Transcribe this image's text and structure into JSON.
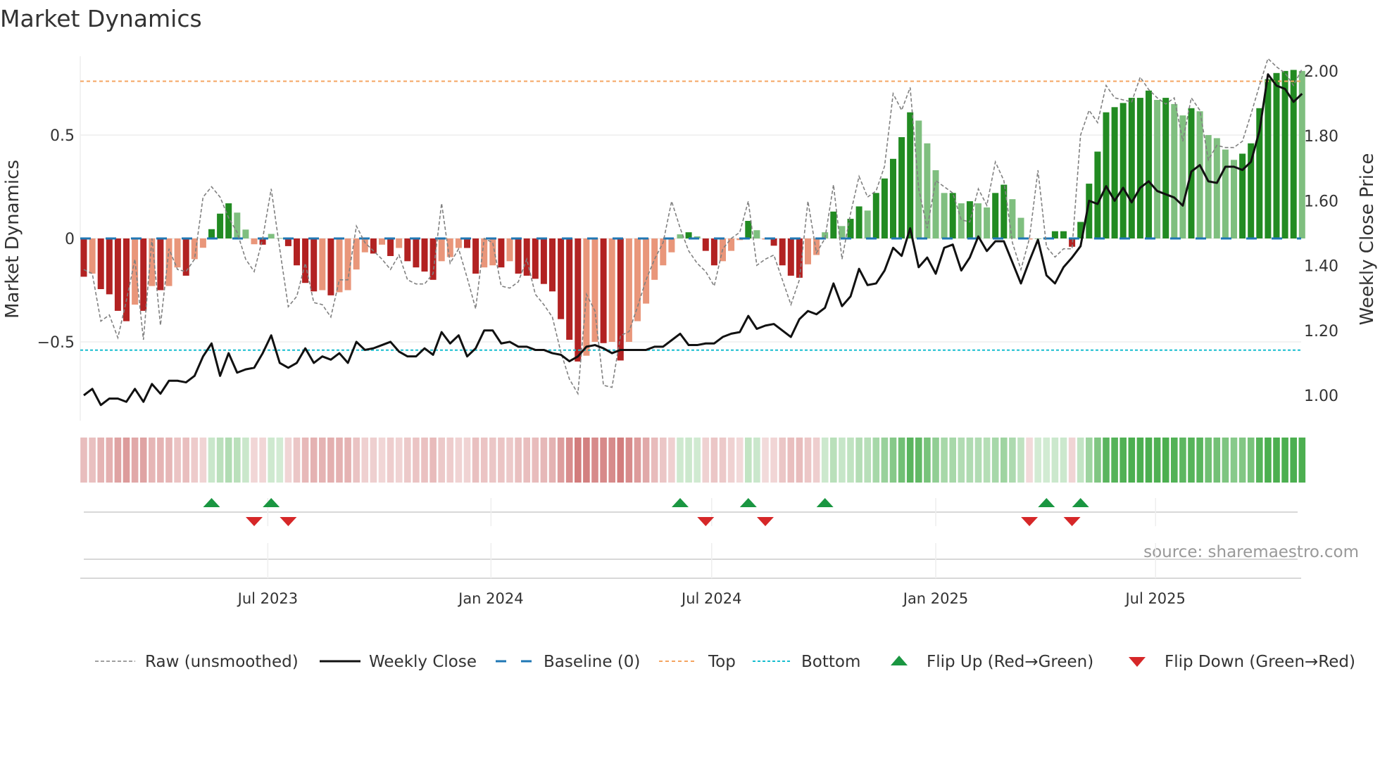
{
  "chart_data": {
    "type": "bar",
    "title": "Market Dynamics",
    "ylabel": "Market Dynamics",
    "ylabel_right": "Weekly Close Price",
    "ylim": [
      -0.77,
      0.86
    ],
    "ylim_right": [
      0.88,
      2.04
    ],
    "yticks": [
      {
        "v": 0.5,
        "label": "0.5"
      },
      {
        "v": 0,
        "label": "0"
      },
      {
        "v": -0.5,
        "label": "−0.5"
      }
    ],
    "yticks_right": [
      {
        "v": 2.0,
        "label": "2.00"
      },
      {
        "v": 1.8,
        "label": "1.80"
      },
      {
        "v": 1.6,
        "label": "1.60"
      },
      {
        "v": 1.4,
        "label": "1.40"
      },
      {
        "v": 1.2,
        "label": "1.20"
      },
      {
        "v": 1.0,
        "label": "1.00"
      }
    ],
    "xticks": [
      {
        "week": 21.6,
        "label": "Jul 2023"
      },
      {
        "week": 47.8,
        "label": "Jan 2024"
      },
      {
        "week": 73.7,
        "label": "Jul 2024"
      },
      {
        "week": 100.0,
        "label": "Jan 2025"
      },
      {
        "week": 125.8,
        "label": "Jul 2025"
      }
    ],
    "top_level": 0.76,
    "bottom_level": -0.54,
    "baseline": 0,
    "colors": {
      "strong_red": "#b22222",
      "weak_red": "#e9967a",
      "strong_green": "#228b22",
      "weak_green": "#7fbf7f",
      "raw": "#808080",
      "close": "#111111",
      "baseline": "#1f77b4",
      "top": "#f4a460",
      "bottom": "#17becf",
      "flip_up": "#1a9641",
      "flip_down": "#d62728"
    },
    "dynamics": [
      -0.185,
      -0.17,
      -0.245,
      -0.27,
      -0.35,
      -0.4,
      -0.32,
      -0.35,
      -0.23,
      -0.25,
      -0.23,
      -0.14,
      -0.18,
      -0.1,
      -0.045,
      0.045,
      0.12,
      0.17,
      0.125,
      0.043,
      -0.028,
      -0.03,
      0.022,
      0.002,
      -0.037,
      -0.13,
      -0.215,
      -0.256,
      -0.25,
      -0.275,
      -0.26,
      -0.25,
      -0.15,
      -0.067,
      -0.073,
      -0.03,
      -0.085,
      -0.046,
      -0.11,
      -0.14,
      -0.16,
      -0.2,
      -0.11,
      -0.09,
      -0.046,
      -0.046,
      -0.17,
      -0.14,
      -0.13,
      -0.14,
      -0.11,
      -0.17,
      -0.18,
      -0.195,
      -0.22,
      -0.256,
      -0.39,
      -0.49,
      -0.595,
      -0.567,
      -0.5,
      -0.506,
      -0.5,
      -0.59,
      -0.5,
      -0.4,
      -0.315,
      -0.2,
      -0.13,
      -0.067,
      0.02,
      0.03,
      0.01,
      -0.06,
      -0.13,
      -0.11,
      -0.06,
      -0.008,
      0.085,
      0.04,
      -0.005,
      -0.035,
      -0.13,
      -0.18,
      -0.19,
      -0.125,
      -0.08,
      0.03,
      0.13,
      0.06,
      0.095,
      0.155,
      0.135,
      0.22,
      0.29,
      0.385,
      0.49,
      0.61,
      0.57,
      0.46,
      0.33,
      0.22,
      0.22,
      0.17,
      0.18,
      0.17,
      0.15,
      0.22,
      0.26,
      0.19,
      0.1,
      -0.005,
      0,
      0.005,
      0.035,
      0.035,
      -0.04,
      0.08,
      0.265,
      0.42,
      0.61,
      0.635,
      0.655,
      0.68,
      0.68,
      0.715,
      0.67,
      0.68,
      0.65,
      0.595,
      0.63,
      0.615,
      0.5,
      0.485,
      0.43,
      0.38,
      0.41,
      0.46,
      0.63,
      0.77,
      0.8,
      0.81,
      0.815,
      0.81
    ],
    "raw": [
      -0.15,
      -0.17,
      -0.4,
      -0.37,
      -0.48,
      -0.3,
      -0.1,
      -0.49,
      0.0,
      -0.42,
      -0.05,
      -0.15,
      -0.16,
      -0.1,
      0.2,
      0.25,
      0.2,
      0.1,
      0.03,
      -0.1,
      -0.16,
      0.0,
      0.24,
      -0.05,
      -0.33,
      -0.28,
      -0.12,
      -0.31,
      -0.32,
      -0.38,
      -0.2,
      -0.2,
      0.06,
      -0.02,
      -0.06,
      -0.1,
      -0.15,
      -0.08,
      -0.2,
      -0.22,
      -0.22,
      -0.17,
      0.17,
      -0.12,
      -0.05,
      -0.19,
      -0.34,
      0.0,
      -0.02,
      -0.23,
      -0.24,
      -0.21,
      -0.1,
      -0.27,
      -0.32,
      -0.38,
      -0.55,
      -0.68,
      -0.75,
      -0.27,
      -0.35,
      -0.71,
      -0.72,
      -0.47,
      -0.45,
      -0.33,
      -0.2,
      -0.1,
      -0.02,
      0.18,
      0.05,
      -0.06,
      -0.12,
      -0.16,
      -0.23,
      -0.05,
      0.0,
      0.03,
      0.18,
      -0.13,
      -0.1,
      -0.08,
      -0.2,
      -0.32,
      -0.2,
      0.18,
      -0.07,
      0.0,
      0.26,
      -0.1,
      0.12,
      0.3,
      0.2,
      0.23,
      0.35,
      0.7,
      0.62,
      0.73,
      0.24,
      0.05,
      0.28,
      0.25,
      0.22,
      0.09,
      0.08,
      0.24,
      0.16,
      0.37,
      0.28,
      -0.02,
      -0.15,
      0.0,
      0.33,
      -0.04,
      -0.09,
      -0.05,
      -0.05,
      0.5,
      0.62,
      0.56,
      0.74,
      0.68,
      0.67,
      0.66,
      0.78,
      0.72,
      0.68,
      0.65,
      0.68,
      0.47,
      0.68,
      0.62,
      0.38,
      0.45,
      0.44,
      0.44,
      0.47,
      0.6,
      0.74,
      0.87,
      0.83,
      0.8,
      0.74,
      0.82
    ],
    "close": [
      1.0,
      1.02,
      0.97,
      0.99,
      0.99,
      0.98,
      1.02,
      0.98,
      1.035,
      1.005,
      1.045,
      1.045,
      1.04,
      1.06,
      1.12,
      1.16,
      1.06,
      1.13,
      1.07,
      1.08,
      1.085,
      1.13,
      1.185,
      1.1,
      1.085,
      1.1,
      1.145,
      1.1,
      1.12,
      1.11,
      1.13,
      1.1,
      1.165,
      1.14,
      1.145,
      1.155,
      1.165,
      1.135,
      1.12,
      1.12,
      1.145,
      1.125,
      1.195,
      1.16,
      1.185,
      1.12,
      1.145,
      1.2,
      1.2,
      1.16,
      1.165,
      1.15,
      1.15,
      1.14,
      1.14,
      1.13,
      1.125,
      1.105,
      1.12,
      1.15,
      1.155,
      1.145,
      1.13,
      1.14,
      1.14,
      1.14,
      1.14,
      1.15,
      1.15,
      1.17,
      1.19,
      1.155,
      1.155,
      1.16,
      1.16,
      1.18,
      1.19,
      1.195,
      1.245,
      1.205,
      1.215,
      1.22,
      1.2,
      1.18,
      1.235,
      1.26,
      1.25,
      1.27,
      1.345,
      1.275,
      1.305,
      1.39,
      1.34,
      1.345,
      1.385,
      1.455,
      1.43,
      1.515,
      1.395,
      1.425,
      1.375,
      1.455,
      1.465,
      1.385,
      1.425,
      1.49,
      1.445,
      1.475,
      1.475,
      1.41,
      1.345,
      1.415,
      1.48,
      1.37,
      1.345,
      1.395,
      1.425,
      1.46,
      1.6,
      1.59,
      1.645,
      1.6,
      1.64,
      1.595,
      1.64,
      1.66,
      1.63,
      1.62,
      1.61,
      1.585,
      1.69,
      1.71,
      1.66,
      1.655,
      1.705,
      1.705,
      1.695,
      1.72,
      1.815,
      1.99,
      1.955,
      1.945,
      1.905,
      1.93
    ],
    "flip_up_weeks": [
      15,
      22,
      70,
      78,
      87,
      113,
      117
    ],
    "flip_down_weeks": [
      20,
      24,
      73,
      80,
      111,
      116
    ],
    "legend": [
      {
        "key": "raw",
        "label": "Raw (unsmoothed)"
      },
      {
        "key": "close",
        "label": "Weekly Close"
      },
      {
        "key": "baseline",
        "label": "Baseline (0)"
      },
      {
        "key": "top",
        "label": "Top"
      },
      {
        "key": "bottom",
        "label": "Bottom"
      },
      {
        "key": "flip_up",
        "label": "Flip Up (Red→Green)"
      },
      {
        "key": "flip_down",
        "label": "Flip Down (Green→Red)"
      }
    ],
    "legend_position": "bottom",
    "source": "source: sharemaestro.com"
  }
}
